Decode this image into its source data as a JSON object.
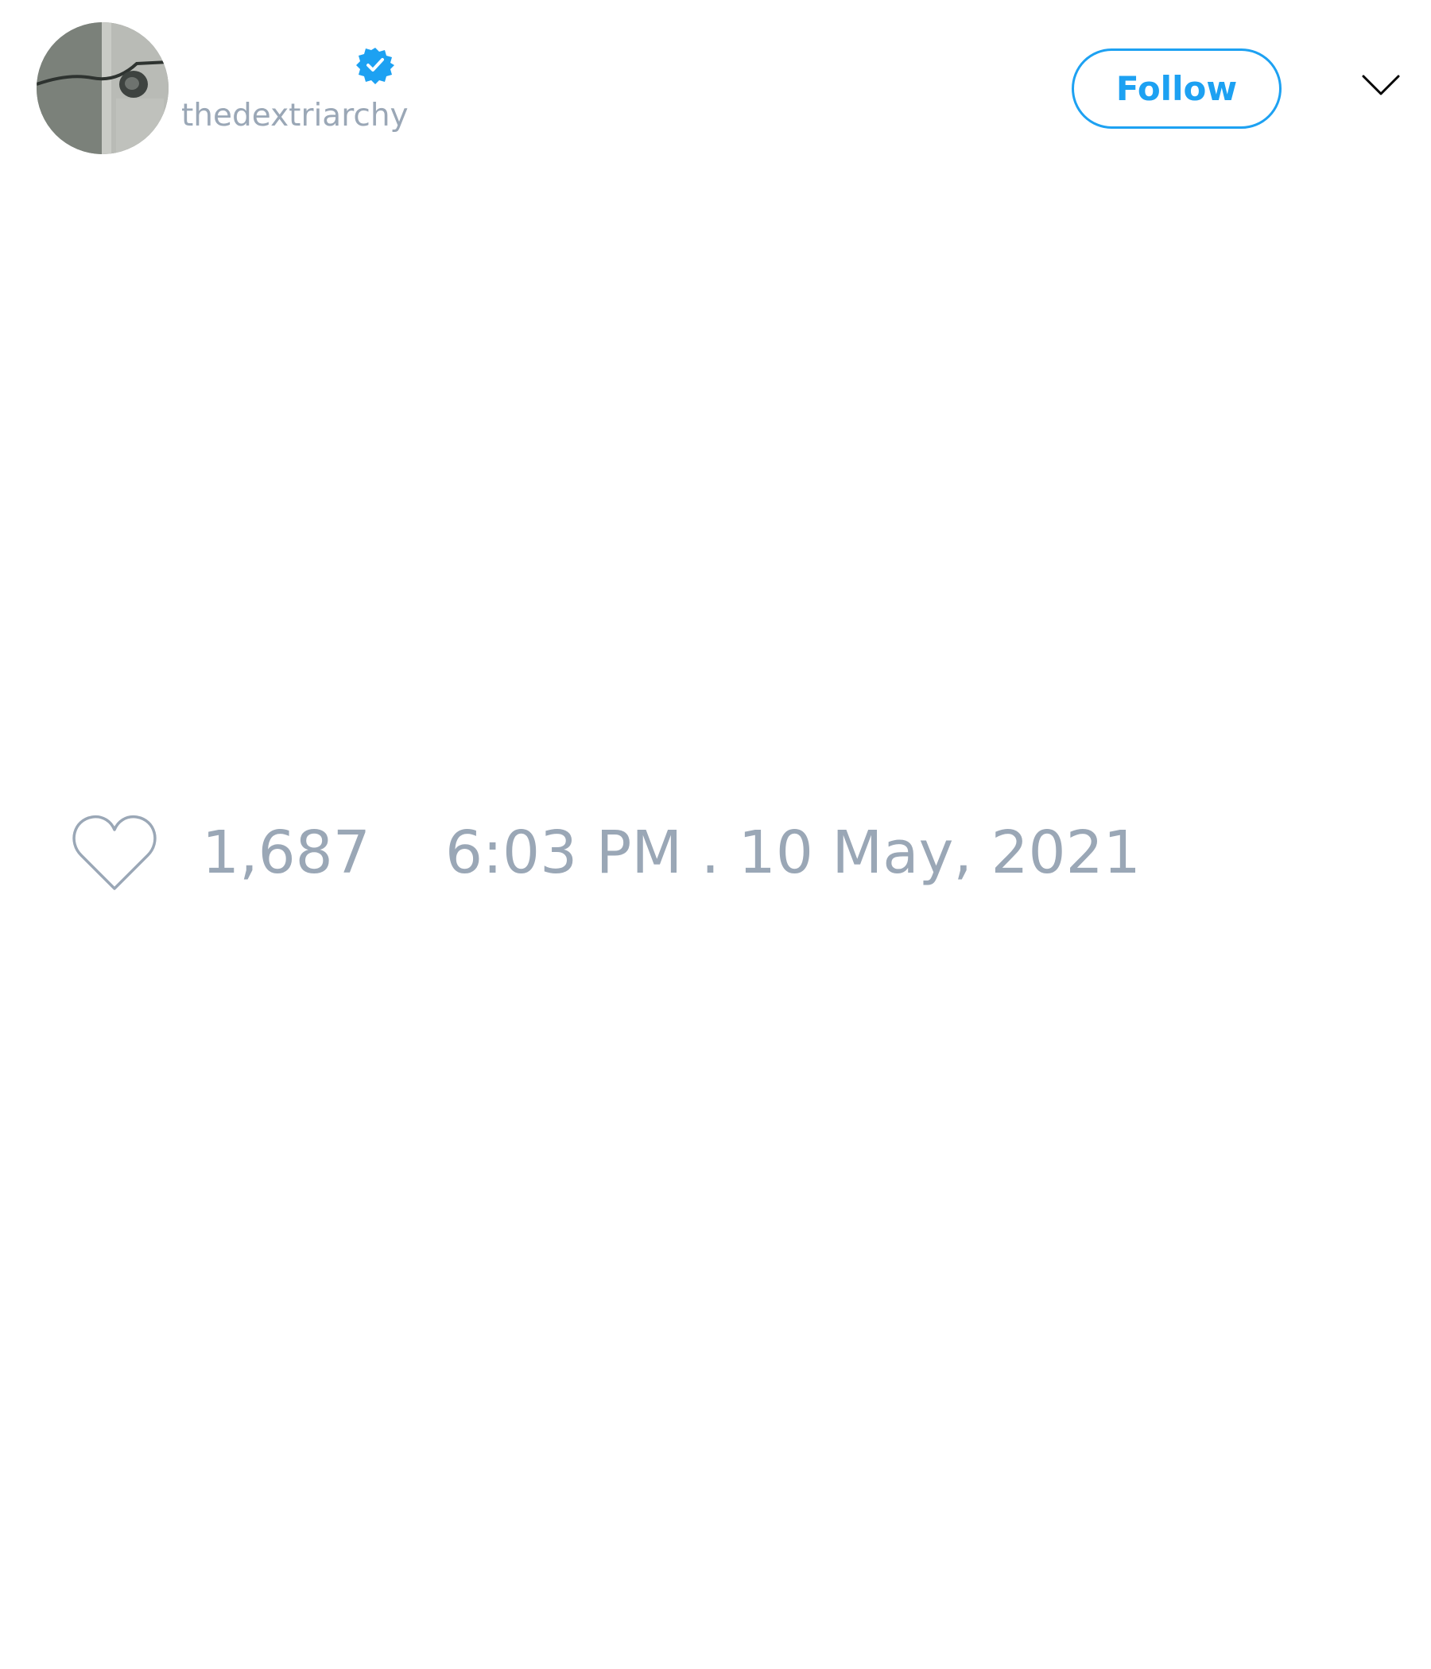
{
  "user": {
    "handle": "thedextriarchy",
    "verified": true,
    "avatar_icon": "profile-photo"
  },
  "actions": {
    "follow_label": "Follow",
    "menu_icon": "chevron-down-icon"
  },
  "engagement": {
    "like_icon": "heart-outline-icon",
    "like_count": "1,687"
  },
  "meta": {
    "timestamp": "6:03 PM . 10 May, 2021"
  },
  "colors": {
    "accent": "#1da1f2",
    "muted_text": "#9aa7b6",
    "background": "#ffffff"
  }
}
